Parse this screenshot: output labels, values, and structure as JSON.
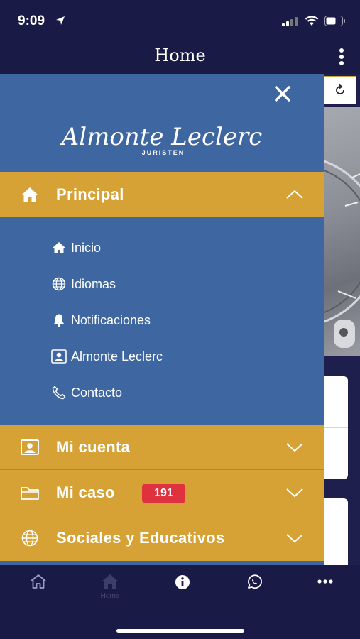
{
  "status_bar": {
    "time": "9:09"
  },
  "header": {
    "title": "Home"
  },
  "drawer": {
    "logo": {
      "script": "Almonte Leclerc",
      "sub": "JURISTEN"
    },
    "sections": [
      {
        "label": "Principal",
        "icon": "home-icon",
        "expanded": true
      },
      {
        "label": "Mi cuenta",
        "icon": "account-icon",
        "expanded": false
      },
      {
        "label": "Mi caso",
        "icon": "folder-icon",
        "expanded": false,
        "badge": "191"
      },
      {
        "label": "Sociales y Educativos",
        "icon": "globe-icon",
        "expanded": false
      }
    ],
    "principal_items": [
      {
        "label": "Inicio",
        "icon": "home-icon"
      },
      {
        "label": "Idiomas",
        "icon": "globe-icon"
      },
      {
        "label": "Notificaciones",
        "icon": "bell-icon"
      },
      {
        "label": "Almonte Leclerc",
        "icon": "contact-card-icon"
      },
      {
        "label": "Contacto",
        "icon": "phone-icon"
      }
    ]
  },
  "bottom_nav": {
    "items": [
      {
        "label": "",
        "icon": "home-outline-icon"
      },
      {
        "label": "Home",
        "icon": "home-filled-icon"
      },
      {
        "label": "",
        "icon": "info-icon"
      },
      {
        "label": "",
        "icon": "whatsapp-icon"
      },
      {
        "label": "",
        "icon": "more-icon"
      }
    ]
  },
  "colors": {
    "navy": "#1a1a46",
    "drawer_blue": "#3e66a0",
    "gold": "#d6a135",
    "badge_red": "#e0313f"
  }
}
